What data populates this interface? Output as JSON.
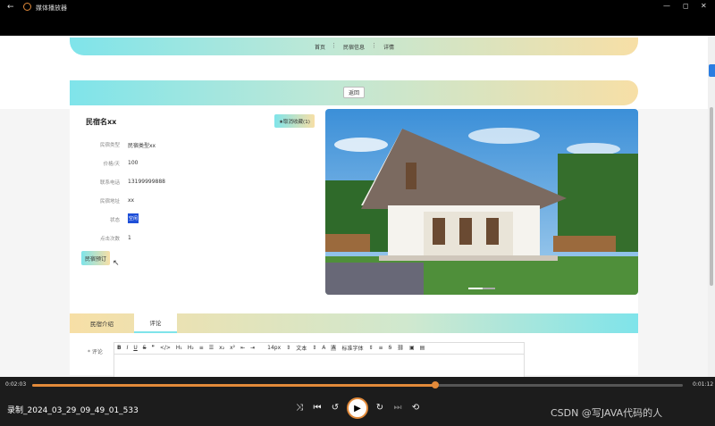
{
  "window": {
    "title": "媒体播放器"
  },
  "breadcrumb": {
    "home": "首页",
    "list": "民宿信息",
    "detail": "详情"
  },
  "search": {
    "button": "返回"
  },
  "house": {
    "name": "民宿名xx",
    "favorite": "★取消收藏(1)",
    "fields": [
      {
        "label": "民宿类型",
        "value": "民宿类型xx"
      },
      {
        "label": "价格/天",
        "value": "100"
      },
      {
        "label": "联系电话",
        "value": "13199999888"
      },
      {
        "label": "民宿地址",
        "value": "xx"
      },
      {
        "label": "状态",
        "value": "空闲"
      },
      {
        "label": "点击次数",
        "value": "1"
      }
    ],
    "book_button": "民宿预订"
  },
  "tabs": {
    "intro": "民宿介绍",
    "comment": "评论"
  },
  "comment": {
    "label": "* 评论"
  },
  "editor": {
    "font_size": "14px",
    "para": "文本",
    "font": "标准字体"
  },
  "player": {
    "elapsed": "0:02:03",
    "total": "0:01:12",
    "progress": 0.62,
    "filename": "录制_2024_03_29_09_49_01_533"
  },
  "watermark": "CSDN @写JAVA代码的人"
}
